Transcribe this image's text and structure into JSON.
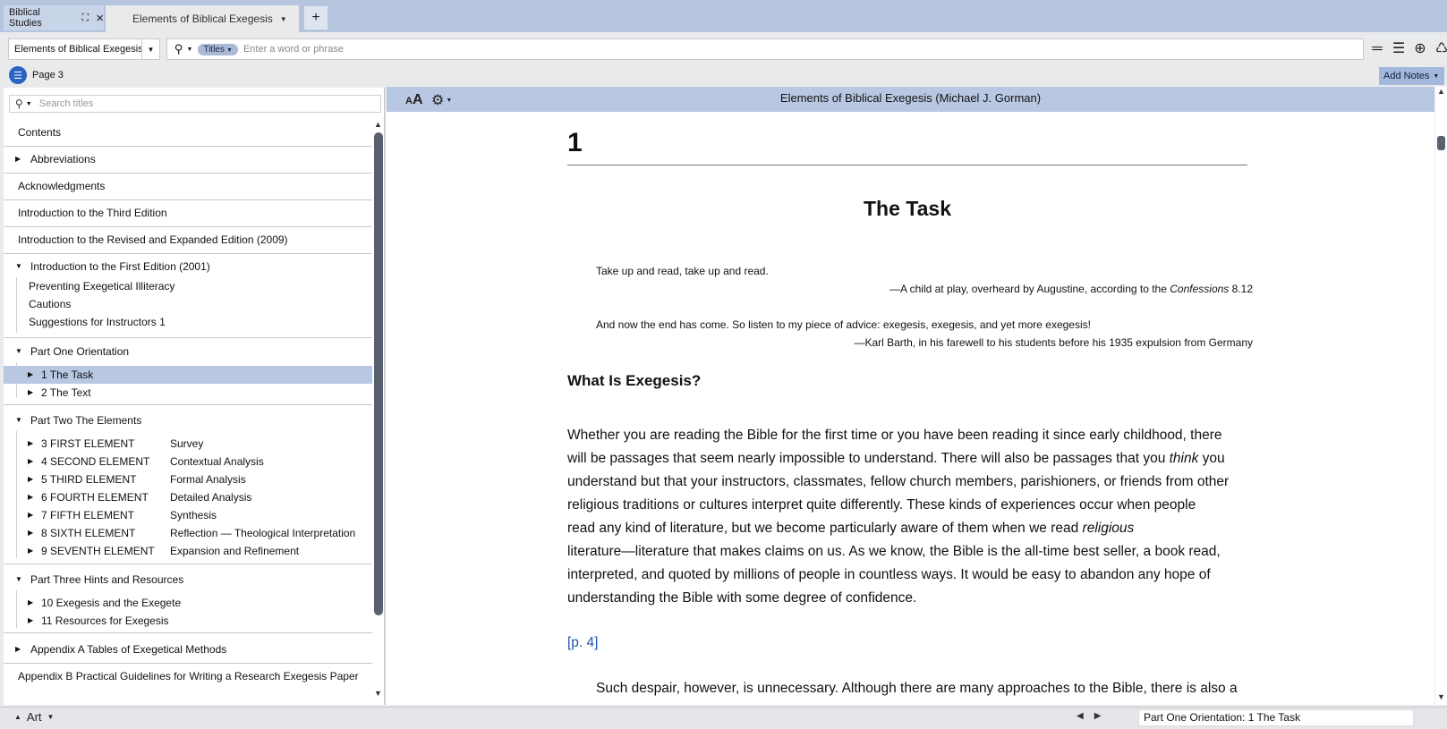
{
  "tabs": {
    "panel_tab": "Biblical Studies",
    "doc_tab": "Elements of Biblical Exegesis",
    "new_tab": "+"
  },
  "toolbar": {
    "resource": "Elements of Biblical Exegesis",
    "search_scope": "Titles",
    "search_placeholder": "Enter a word or phrase"
  },
  "pagerow": {
    "page_label": "Page 3",
    "add_notes": "Add Notes"
  },
  "toc_panel": {
    "search_placeholder": "Search titles",
    "items": [
      {
        "label": "Contents"
      },
      {
        "label": "Abbreviations"
      },
      {
        "label": "Acknowledgments"
      },
      {
        "label": "Introduction to the Third Edition"
      },
      {
        "label": "Introduction to the Revised and Expanded Edition (2009)"
      },
      {
        "label": "Introduction to the First Edition (2001)",
        "children": [
          "Preventing Exegetical Illiteracy",
          "Cautions",
          "Suggestions for Instructors 1"
        ]
      },
      {
        "label": "Part One Orientation",
        "children": [
          "1 The Task",
          "2 The Text"
        ]
      },
      {
        "label": "Part Two The Elements",
        "children": [
          {
            "label": "3 FIRST ELEMENT",
            "desc": "Survey"
          },
          {
            "label": "4 SECOND ELEMENT",
            "desc": "Contextual Analysis"
          },
          {
            "label": "5 THIRD ELEMENT",
            "desc": "Formal Analysis"
          },
          {
            "label": "6 FOURTH ELEMENT",
            "desc": "Detailed Analysis"
          },
          {
            "label": "7 FIFTH ELEMENT",
            "desc": "Synthesis"
          },
          {
            "label": "8 SIXTH ELEMENT",
            "desc": "Reflection — Theological Interpretation"
          },
          {
            "label": "9 SEVENTH ELEMENT",
            "desc": "Expansion and Refinement"
          }
        ]
      },
      {
        "label": "Part Three Hints and Resources",
        "children": [
          "10 Exegesis and the Exegete",
          "11 Resources for Exegesis"
        ]
      },
      {
        "label": "Appendix A Tables of Exegetical Methods"
      },
      {
        "label": "Appendix B Practical Guidelines for Writing a Research Exegesis Paper"
      }
    ]
  },
  "reader": {
    "book_title": "Elements of Biblical Exegesis (Michael J. Gorman)",
    "chapter_number": "1",
    "chapter_title": "The Task",
    "epigraph1": {
      "quote": "Take up and read, take up and read.",
      "attr_prefix": "—A child at play, overheard by Augustine, according to the ",
      "attr_work": "Confessions",
      "attr_suffix": " 8.12"
    },
    "epigraph2": {
      "quote": "And now the end has come. So listen to my piece of advice: exegesis, exegesis, and yet more exegesis!",
      "attr": "—Karl Barth, in his farewell to his students before his 1935 expulsion from Germany"
    },
    "section_heading": "What Is Exegesis?",
    "para_lines": {
      "l1": "Whether you are reading the Bible for the first time or you have been reading it since early childhood, there",
      "l2a": "will be passages that seem nearly impossible to understand. There will also be passages that you ",
      "l2i": "think",
      "l2b": " you",
      "l3": "understand but that your instructors, classmates, fellow church members, parishioners, or friends from other",
      "l4": "religious traditions or cultures interpret quite differently. These kinds of experiences occur when people",
      "l5a": "read any kind of literature, but we become particularly aware of them when we read ",
      "l5i": "religious",
      "l6": "literature—literature that makes claims on us. As we know, the Bible is the all-time best seller, a book read,",
      "l7": "interpreted, and quoted by millions of people in countless ways. It would be easy to abandon any hope of",
      "l8": "understanding the Bible with some degree of confidence."
    },
    "page_ref": "[p. 4]",
    "para2": "Such despair, however, is unnecessary. Although there are many approaches to the Bible, there is also a"
  },
  "statusbar": {
    "layout": "Art",
    "location": "Part One Orientation: 1 The Task"
  }
}
